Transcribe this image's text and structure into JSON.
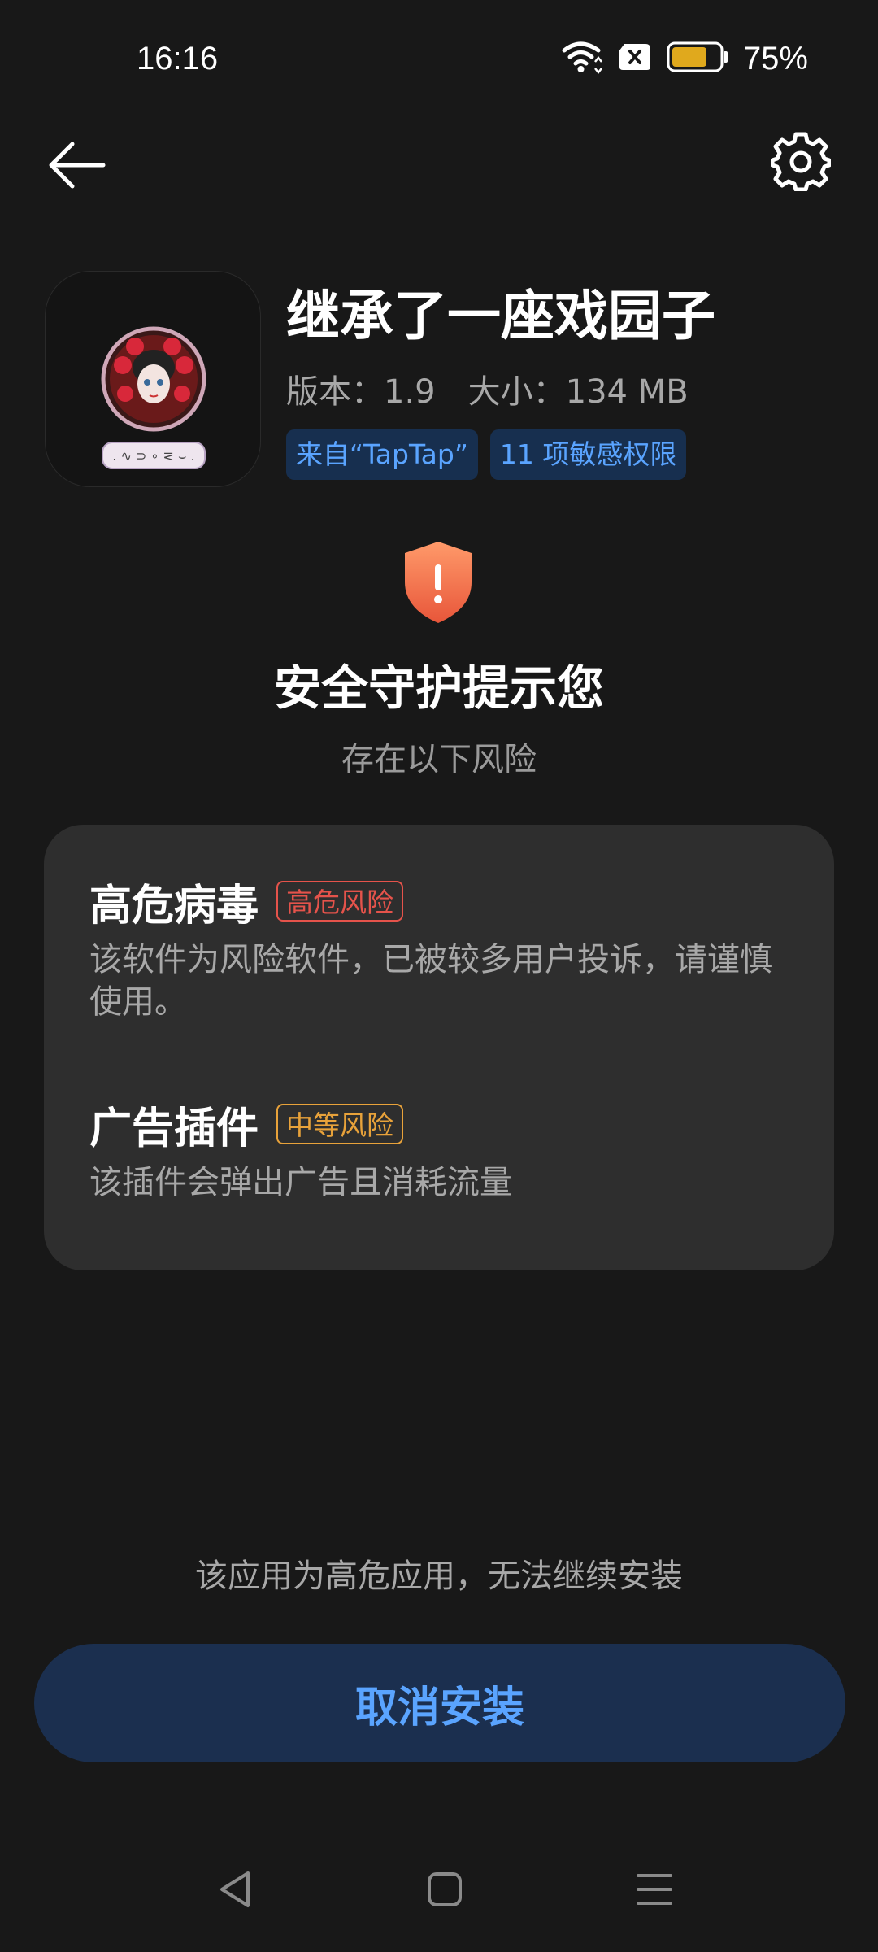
{
  "status_bar": {
    "time": "16:16",
    "battery_percent": "75%",
    "battery_level": 0.75,
    "battery_color": "#e0a91d",
    "icons": [
      "wifi-icon",
      "sim-none-icon",
      "battery-icon"
    ]
  },
  "header": {
    "back_icon": "arrow-left-icon",
    "settings_icon": "gear-icon"
  },
  "app": {
    "name": "继承了一座戏园子",
    "version_label": "版本：1.9",
    "size_label": "大小：134 MB",
    "tags": [
      {
        "label": "来自“TapTap”"
      },
      {
        "label": "11 项敏感权限"
      }
    ]
  },
  "warning": {
    "shield_icon": "shield-exclamation-icon",
    "headline": "安全守护提示您",
    "subheadline": "存在以下风险"
  },
  "risks": [
    {
      "title": "高危病毒",
      "badge": "高危风险",
      "badge_color": "#e5534b",
      "description": "该软件为风险软件，已被较多用户投诉，请谨慎使用。"
    },
    {
      "title": "广告插件",
      "badge": "中等风险",
      "badge_color": "#e8a23a",
      "description": "该插件会弹出广告且消耗流量"
    }
  ],
  "footer": {
    "notice": "该应用为高危应用，无法继续安装",
    "cancel_label": "取消安装",
    "accent_color": "#5aa4ff"
  },
  "nav_bar": {
    "icons": [
      "nav-back-icon",
      "nav-home-icon",
      "nav-recents-icon"
    ]
  }
}
